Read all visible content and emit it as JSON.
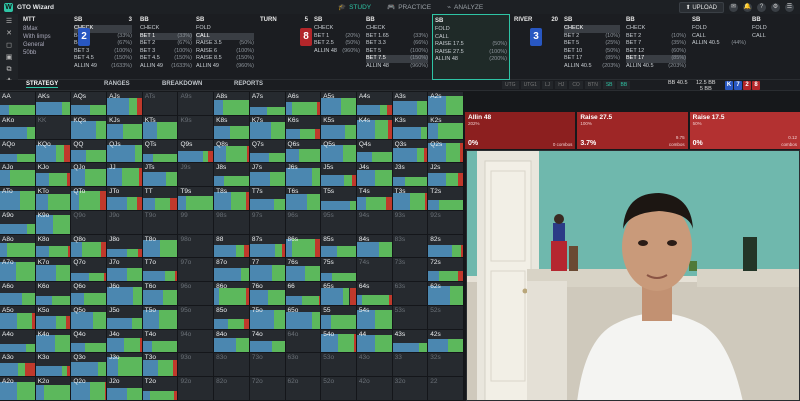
{
  "app_title": "GTO Wizard",
  "nav": {
    "study": "STUDY",
    "practice": "PRACTICE",
    "analyze": "ANALYZE",
    "upload": "UPLOAD"
  },
  "mtt": {
    "title": "MTT",
    "format": "8Max",
    "limps": "With limps",
    "general": "General",
    "stack": "50bb"
  },
  "columns": [
    {
      "pos": "SB",
      "num": "3",
      "actions": [
        [
          "CHECK",
          ""
        ],
        [
          "BET 1",
          "(33%)"
        ],
        [
          "BET 2",
          "(67%)"
        ],
        [
          "BET 3",
          "(100%)"
        ],
        [
          "BET 4.5",
          "(150%)"
        ],
        [
          "ALLIN 49",
          "(1633%)"
        ]
      ],
      "hl": 0
    },
    {
      "pos": "BB",
      "num": "",
      "actions": [
        [
          "CHECK",
          ""
        ],
        [
          "BET 1",
          "(33%)"
        ],
        [
          "BET 2",
          "(67%)"
        ],
        [
          "BET 3",
          "(100%)"
        ],
        [
          "BET 4.5",
          "(150%)"
        ],
        [
          "ALLIN 49",
          "(1633%)"
        ]
      ],
      "hl": 1
    },
    {
      "pos": "SB",
      "num": "",
      "actions": [
        [
          "FOLD",
          ""
        ],
        [
          "CALL",
          ""
        ],
        [
          "RAISE 3.5",
          "(50%)"
        ],
        [
          "RAISE 6",
          "(100%)"
        ],
        [
          "RAISE 8.5",
          "(150%)"
        ],
        [
          "ALLIN 49",
          "(960%)"
        ]
      ],
      "hl": 1
    },
    {
      "pos": "TURN",
      "num": "5",
      "actions": [],
      "hl": -1
    },
    {
      "pos": "SB",
      "num": "",
      "actions": [
        [
          "CHECK",
          ""
        ],
        [
          "BET 1",
          "(20%)"
        ],
        [
          "BET 2.5",
          "(50%)"
        ],
        [
          "ALLIN 48",
          "(960%)"
        ]
      ],
      "hl": -1
    },
    {
      "pos": "BB",
      "num": "",
      "actions": [
        [
          "CHECK",
          ""
        ],
        [
          "BET 1.65",
          "(33%)"
        ],
        [
          "BET 3.3",
          "(66%)"
        ],
        [
          "BET 5",
          "(100%)"
        ],
        [
          "BET 7.5",
          "(150%)"
        ],
        [
          "ALLIN 48",
          "(960%)"
        ]
      ],
      "hl": 4
    },
    {
      "pos": "SB",
      "num": "",
      "actions": [
        [
          "FOLD",
          ""
        ],
        [
          "CALL",
          ""
        ],
        [
          "RAISE 17.5",
          "(50%)"
        ],
        [
          "RAISE 27.5",
          "(100%)"
        ],
        [
          "ALLIN 48",
          "(200%)"
        ]
      ],
      "hl": -1,
      "sel": true
    },
    {
      "pos": "RIVER",
      "num": "20",
      "actions": [],
      "hl": -1
    },
    {
      "pos": "SB",
      "num": "",
      "actions": [
        [
          "CHECK",
          ""
        ],
        [
          "BET 2",
          "(10%)"
        ],
        [
          "BET 5",
          "(25%)"
        ],
        [
          "BET 10",
          "(50%)"
        ],
        [
          "BET 17",
          "(85%)"
        ],
        [
          "ALLIN 40.5",
          "(203%)"
        ]
      ],
      "hl": 0
    },
    {
      "pos": "BB",
      "num": "",
      "actions": [
        [
          "CHECK",
          ""
        ],
        [
          "BET 2",
          "(10%)"
        ],
        [
          "BET 7",
          "(35%)"
        ],
        [
          "BET 12",
          "(60%)"
        ],
        [
          "BET 17",
          "(85%)"
        ],
        [
          "ALLIN 40.5",
          "(203%)"
        ]
      ],
      "hl": 4
    },
    {
      "pos": "SB",
      "num": "",
      "actions": [
        [
          "FOLD",
          ""
        ],
        [
          "CALL",
          ""
        ],
        [
          "ALLIN 40.5",
          "(44%)"
        ]
      ],
      "hl": -1
    },
    {
      "pos": "BB",
      "num": "",
      "actions": [
        [
          "FOLD",
          ""
        ],
        [
          "CALL",
          ""
        ]
      ],
      "hl": -1
    }
  ],
  "tabs": {
    "strategy": "STRATEGY",
    "ranges": "RANGES",
    "breakdown": "BREAKDOWN",
    "reports": "REPORTS"
  },
  "positions": [
    "UTG",
    "UTG1",
    "LJ",
    "HJ",
    "CO",
    "BTN",
    "SB",
    "BB"
  ],
  "pot": {
    "bb1": "BB",
    "bb1v": "40.5",
    "bb2": "12.5 BB",
    "bb2v": "5 BB"
  },
  "board": [
    {
      "r": "K",
      "c": "#2857c2"
    },
    {
      "r": "7",
      "c": "#2857c2"
    },
    {
      "r": "2",
      "c": "#b3262a"
    },
    {
      "r": "8",
      "c": "#b3262a"
    }
  ],
  "turn_card": {
    "r": "8",
    "c": "#b3262a"
  },
  "river_card": {
    "r": "3",
    "c": "#2857c2"
  },
  "flop_card": {
    "r": "2",
    "c": "#2857c2"
  },
  "action_boxes": [
    {
      "name": "Allin 48",
      "sub": "202%",
      "big": "0%",
      "v2": "",
      "combos": "0 combos",
      "color": "#8c1f1f"
    },
    {
      "name": "Raise 27.5",
      "sub": "100%",
      "big": "3.7%",
      "v2": "9.75",
      "combos": "combos",
      "color": "#9e2626"
    },
    {
      "name": "Raise 17.5",
      "sub": "50%",
      "big": "0%",
      "v2": "0.12",
      "combos": "combos",
      "color": "#b33131"
    }
  ],
  "hands": [
    [
      "AA",
      "AKs",
      "AQs",
      "AJs",
      "ATs",
      "A9s",
      "A8s",
      "A7s",
      "A6s",
      "A5s",
      "A4s",
      "A3s",
      "A2s"
    ],
    [
      "AKo",
      "KK",
      "KQs",
      "KJs",
      "KTs",
      "K9s",
      "K8s",
      "K7s",
      "K6s",
      "K5s",
      "K4s",
      "K3s",
      "K2s"
    ],
    [
      "AQo",
      "KQo",
      "QQ",
      "QJs",
      "QTs",
      "Q9s",
      "Q8s",
      "Q7s",
      "Q6s",
      "Q5s",
      "Q4s",
      "Q3s",
      "Q2s"
    ],
    [
      "AJo",
      "KJo",
      "QJo",
      "JJ",
      "JTs",
      "J9s",
      "J8s",
      "J7s",
      "J6s",
      "J5s",
      "J4s",
      "J3s",
      "J2s"
    ],
    [
      "ATo",
      "KTo",
      "QTo",
      "JTo",
      "TT",
      "T9s",
      "T8s",
      "T7s",
      "T6s",
      "T5s",
      "T4s",
      "T3s",
      "T2s"
    ],
    [
      "A9o",
      "K9o",
      "Q9o",
      "J9o",
      "T9o",
      "99",
      "98s",
      "97s",
      "96s",
      "95s",
      "94s",
      "93s",
      "92s"
    ],
    [
      "A8o",
      "K8o",
      "Q8o",
      "J8o",
      "T8o",
      "98o",
      "88",
      "87s",
      "86s",
      "85s",
      "84s",
      "83s",
      "82s"
    ],
    [
      "A7o",
      "K7o",
      "Q7o",
      "J7o",
      "T7o",
      "97o",
      "87o",
      "77",
      "76s",
      "75s",
      "74s",
      "73s",
      "72s"
    ],
    [
      "A6o",
      "K6o",
      "Q6o",
      "J6o",
      "T6o",
      "96o",
      "86o",
      "76o",
      "66",
      "65s",
      "64s",
      "63s",
      "62s"
    ],
    [
      "A5o",
      "K5o",
      "Q5o",
      "J5o",
      "T5o",
      "95o",
      "85o",
      "75o",
      "65o",
      "55",
      "54s",
      "53s",
      "52s"
    ],
    [
      "A4o",
      "K4o",
      "Q4o",
      "J4o",
      "T4o",
      "94o",
      "84o",
      "74o",
      "64o",
      "54o",
      "44",
      "43s",
      "42s"
    ],
    [
      "A3o",
      "K3o",
      "Q3o",
      "J3o",
      "T3o",
      "93o",
      "83o",
      "73o",
      "63o",
      "53o",
      "43o",
      "33",
      "32s"
    ],
    [
      "A2o",
      "K2o",
      "Q2o",
      "J2o",
      "T2o",
      "92o",
      "82o",
      "72o",
      "62o",
      "52o",
      "42o",
      "32o",
      "22"
    ]
  ],
  "dim_hands": [
    "ATs",
    "KK",
    "A9s",
    "K9s",
    "J9s",
    "Q9o",
    "J9o",
    "T9o",
    "99",
    "98s",
    "97s",
    "96s",
    "95s",
    "94s",
    "93s",
    "92s",
    "98o",
    "97o",
    "96o",
    "95o",
    "94o",
    "93o",
    "92o",
    "33",
    "83s",
    "74s",
    "73s",
    "63s",
    "53s",
    "52s",
    "32s",
    "64o",
    "53o",
    "83o",
    "93o",
    "73o",
    "63o",
    "43o",
    "32o",
    "22",
    "42o",
    "52o",
    "62o",
    "72o",
    "82o"
  ],
  "colors": {
    "accent": "#2ec4a5",
    "fold": "#4b87b0",
    "call": "#5cb85c",
    "raise": "#c0392b"
  }
}
